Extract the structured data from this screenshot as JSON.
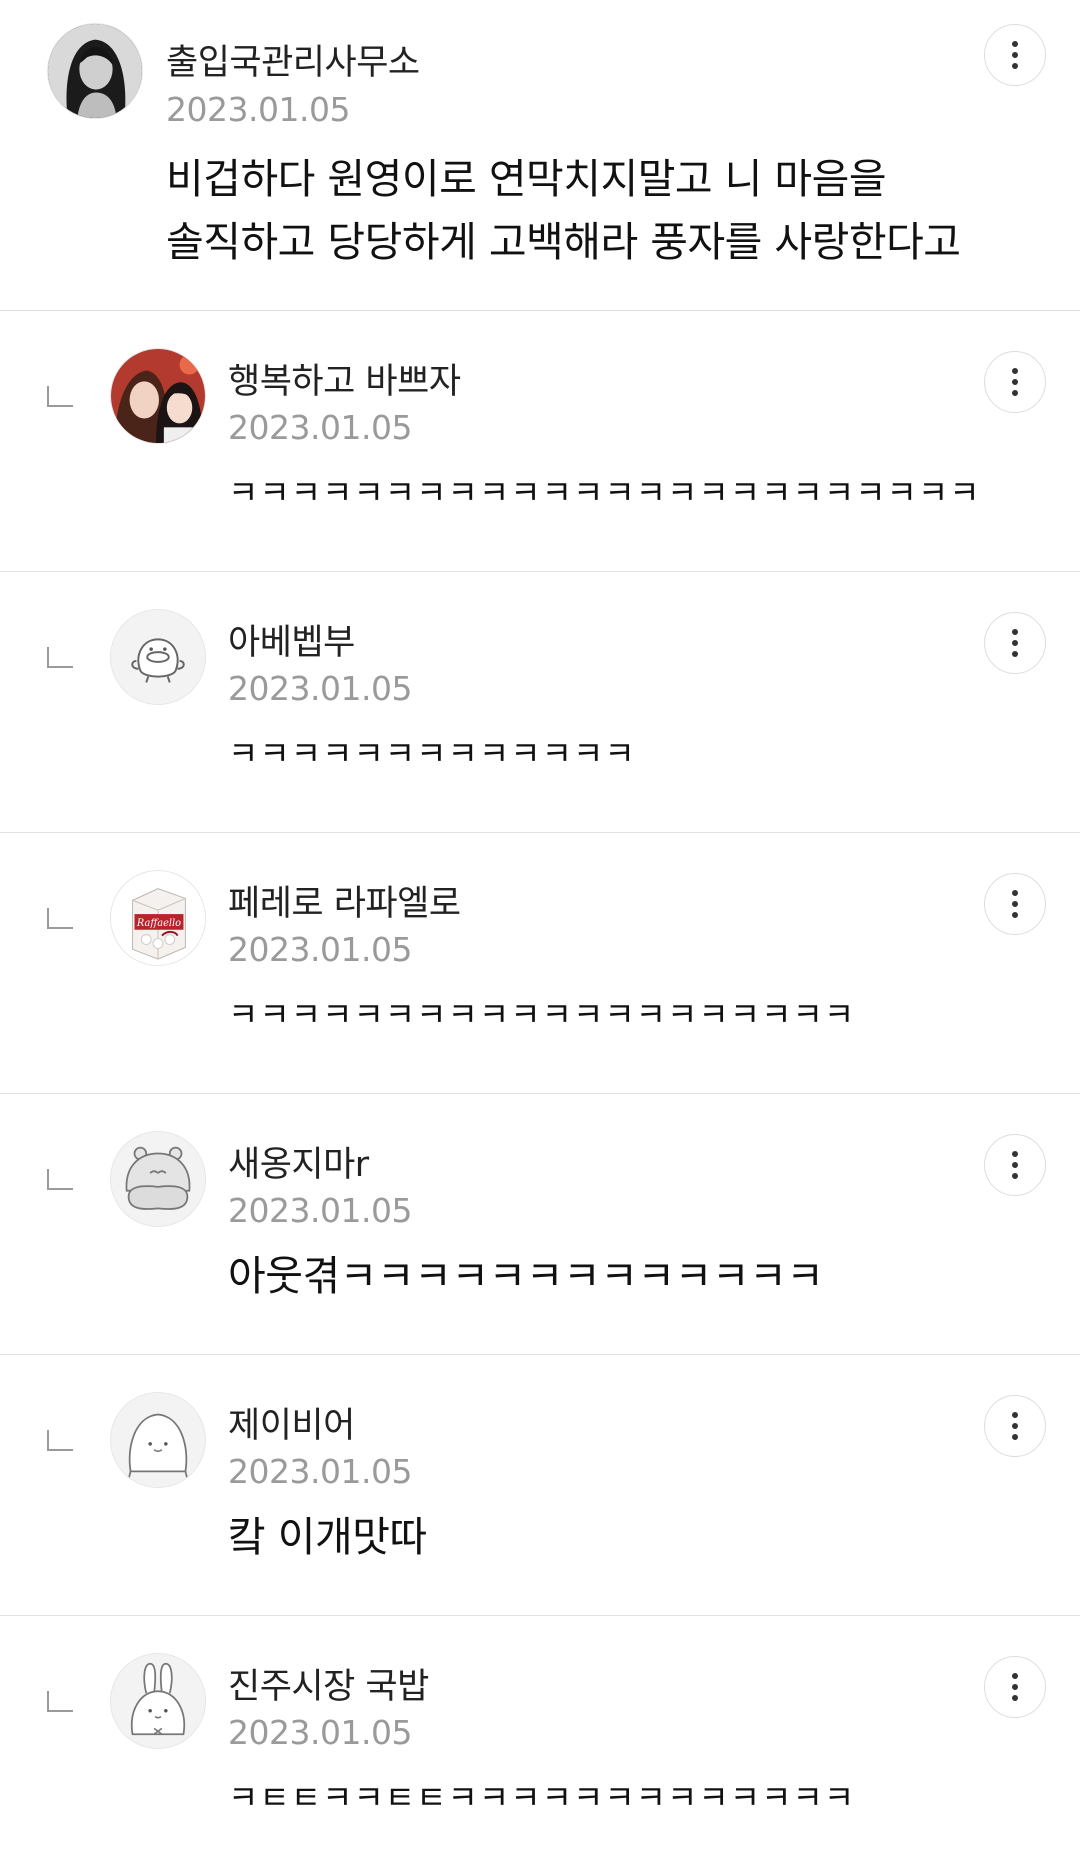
{
  "comments": [
    {
      "type": "main",
      "nickname": "출입국관리사무소",
      "date": "2023.01.05",
      "text_line1": "비겁하다 원영이로 연막치지말고 니 마음을",
      "text_line2": "솔직하고 당당하게 고백해라 풍자를 사랑한다고",
      "avatar_icon": "profile-photo-woman"
    },
    {
      "type": "reply",
      "nickname": "행복하고 바쁘자",
      "date": "2023.01.05",
      "text": "ㅋㅋㅋㅋㅋㅋㅋㅋㅋㅋㅋㅋㅋㅋㅋㅋㅋㅋㅋㅋㅋㅋㅋㅋ",
      "avatar_icon": "profile-photo-two-girls"
    },
    {
      "type": "reply",
      "nickname": "아베벱부",
      "date": "2023.01.05",
      "text": "ㅋㅋㅋㅋㅋㅋㅋㅋㅋㅋㅋㅋㅋ",
      "avatar_icon": "default-avatar-character"
    },
    {
      "type": "reply",
      "nickname": "페레로 라파엘로",
      "date": "2023.01.05",
      "text": "ㅋㅋㅋㅋㅋㅋㅋㅋㅋㅋㅋㅋㅋㅋㅋㅋㅋㅋㅋㅋ",
      "avatar_icon": "profile-photo-raffaello-box",
      "avatar_brand_text": "Raffaello"
    },
    {
      "type": "reply",
      "nickname": "새옹지마r",
      "date": "2023.01.05",
      "text": "아웃겪ㅋㅋㅋㅋㅋㅋㅋㅋㅋㅋㅋㅋㅋ",
      "avatar_icon": "default-avatar-hippo"
    },
    {
      "type": "reply",
      "nickname": "제이비어",
      "date": "2023.01.05",
      "text": "캌 이개맛따",
      "avatar_icon": "default-avatar-blob"
    },
    {
      "type": "reply",
      "nickname": "진주시장 국밥",
      "date": "2023.01.05",
      "text": "ㅋㅌㅌㅋㅋㅌㅌㅋㅋㅋㅋㅋㅋㅋㅋㅋㅋㅋㅋㅋ",
      "avatar_icon": "default-avatar-rabbit"
    }
  ],
  "colors": {
    "divider": "#e2e2e2",
    "date": "#9a9a9a",
    "text": "#111111"
  }
}
